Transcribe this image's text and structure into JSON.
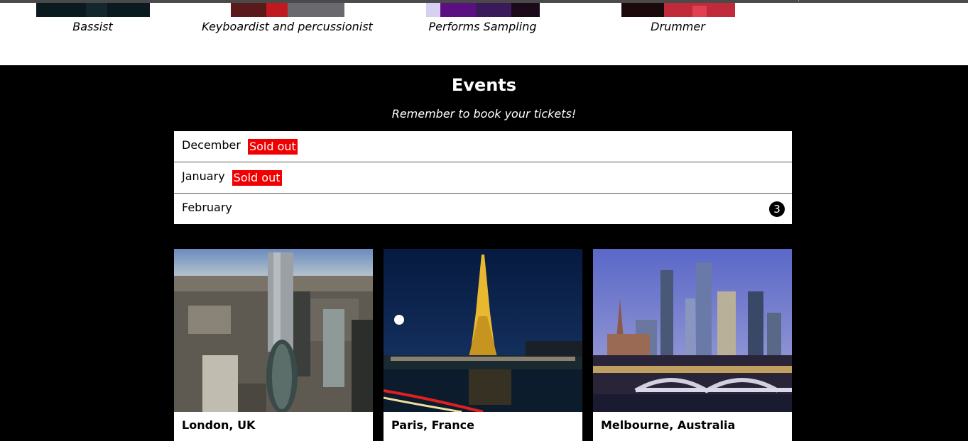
{
  "band": {
    "members": [
      {
        "role": "Bassist"
      },
      {
        "role": "Keyboardist and percussionist"
      },
      {
        "role": "Performs Sampling"
      },
      {
        "role": "Drummer"
      }
    ]
  },
  "events": {
    "title": "Events",
    "subtitle": "Remember to book your tickets!",
    "months": [
      {
        "name": "December",
        "tag": "Sold out"
      },
      {
        "name": "January",
        "tag": "Sold out"
      },
      {
        "name": "February",
        "count": "3"
      }
    ],
    "cities": [
      {
        "name": "London, UK"
      },
      {
        "name": "Paris, France"
      },
      {
        "name": "Melbourne, Australia"
      }
    ]
  },
  "colors": {
    "sold_out": "#f00000",
    "section_bg": "#000000"
  }
}
